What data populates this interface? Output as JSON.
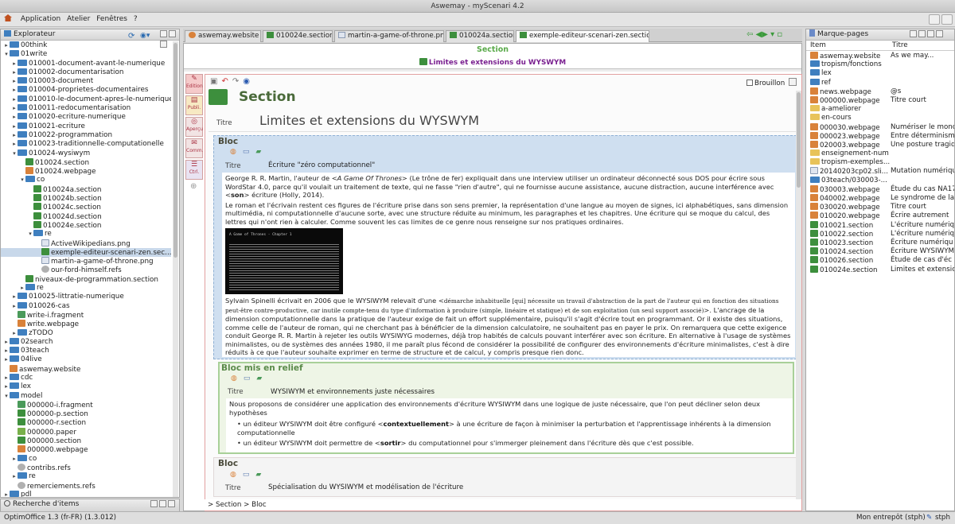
{
  "window_title": "Aswemay - myScenari 4.2",
  "menu": [
    "Application",
    "Atelier",
    "Fenêtres",
    "?"
  ],
  "explorer": {
    "title": "Explorateur",
    "items": [
      {
        "d": 0,
        "a": "▸",
        "t": "folder",
        "label": "00think"
      },
      {
        "d": 0,
        "a": "▾",
        "t": "folder",
        "label": "01write"
      },
      {
        "d": 1,
        "a": "▸",
        "t": "folder",
        "label": "010001-document-avant-le-numerique"
      },
      {
        "d": 1,
        "a": "▸",
        "t": "folder",
        "label": "010002-documentarisation"
      },
      {
        "d": 1,
        "a": "▸",
        "t": "folder",
        "label": "010003-document"
      },
      {
        "d": 1,
        "a": "▸",
        "t": "folder",
        "label": "010004-proprietes-documentaires"
      },
      {
        "d": 1,
        "a": "▸",
        "t": "folder",
        "label": "010010-le-document-apres-le-numerique"
      },
      {
        "d": 1,
        "a": "▸",
        "t": "folder",
        "label": "010011-redocumentarisation"
      },
      {
        "d": 1,
        "a": "▸",
        "t": "folder",
        "label": "010020-ecriture-numerique"
      },
      {
        "d": 1,
        "a": "▸",
        "t": "folder",
        "label": "010021-ecriture"
      },
      {
        "d": 1,
        "a": "▸",
        "t": "folder",
        "label": "010022-programmation"
      },
      {
        "d": 1,
        "a": "▸",
        "t": "folder",
        "label": "010023-traditionnelle-computationelle"
      },
      {
        "d": 1,
        "a": "▾",
        "t": "folder",
        "label": "010024-wysiwym"
      },
      {
        "d": 2,
        "a": "",
        "t": "sec",
        "label": "010024.section"
      },
      {
        "d": 2,
        "a": "",
        "t": "web",
        "label": "010024.webpage"
      },
      {
        "d": 2,
        "a": "▾",
        "t": "folder",
        "label": "co"
      },
      {
        "d": 3,
        "a": "",
        "t": "sec",
        "label": "010024a.section"
      },
      {
        "d": 3,
        "a": "",
        "t": "sec",
        "label": "010024b.section"
      },
      {
        "d": 3,
        "a": "",
        "t": "sec",
        "label": "010024c.section"
      },
      {
        "d": 3,
        "a": "",
        "t": "sec",
        "label": "010024d.section"
      },
      {
        "d": 3,
        "a": "",
        "t": "sec",
        "label": "010024e.section"
      },
      {
        "d": 3,
        "a": "▾",
        "t": "folder",
        "label": "re"
      },
      {
        "d": 4,
        "a": "",
        "t": "img",
        "label": "ActiveWikipedians.png"
      },
      {
        "d": 4,
        "a": "",
        "t": "sec",
        "label": "exemple-editeur-scenari-zen.sec...",
        "sel": true
      },
      {
        "d": 4,
        "a": "",
        "t": "img",
        "label": "martin-a-game-of-throne.png"
      },
      {
        "d": 4,
        "a": "",
        "t": "ref",
        "label": "our-ford-himself.refs"
      },
      {
        "d": 2,
        "a": "",
        "t": "sec",
        "label": "niveaux-de-programmation.section"
      },
      {
        "d": 2,
        "a": "▸",
        "t": "folder",
        "label": "re"
      },
      {
        "d": 1,
        "a": "▸",
        "t": "folder",
        "label": "010025-littratie-numerique"
      },
      {
        "d": 1,
        "a": "▸",
        "t": "folder",
        "label": "010026-cas"
      },
      {
        "d": 1,
        "a": "",
        "t": "frag",
        "label": "write-i.fragment"
      },
      {
        "d": 1,
        "a": "",
        "t": "web",
        "label": "write.webpage"
      },
      {
        "d": 1,
        "a": "▸",
        "t": "folder",
        "label": "zTODO"
      },
      {
        "d": 0,
        "a": "▸",
        "t": "folder",
        "label": "02search"
      },
      {
        "d": 0,
        "a": "▸",
        "t": "folder",
        "label": "03teach"
      },
      {
        "d": 0,
        "a": "▸",
        "t": "folder",
        "label": "04live"
      },
      {
        "d": 0,
        "a": "",
        "t": "web",
        "label": "aswemay.website"
      },
      {
        "d": 0,
        "a": "▸",
        "t": "folder",
        "label": "cdc"
      },
      {
        "d": 0,
        "a": "▸",
        "t": "folder",
        "label": "lex"
      },
      {
        "d": 0,
        "a": "▾",
        "t": "folder",
        "label": "model"
      },
      {
        "d": 1,
        "a": "",
        "t": "frag",
        "label": "000000-i.fragment"
      },
      {
        "d": 1,
        "a": "",
        "t": "sec",
        "label": "000000-p.section"
      },
      {
        "d": 1,
        "a": "",
        "t": "sec",
        "label": "000000-r.section"
      },
      {
        "d": 1,
        "a": "",
        "t": "pap",
        "label": "000000.paper"
      },
      {
        "d": 1,
        "a": "",
        "t": "sec",
        "label": "000000.section"
      },
      {
        "d": 1,
        "a": "",
        "t": "web",
        "label": "000000.webpage"
      },
      {
        "d": 1,
        "a": "▸",
        "t": "folder",
        "label": "co"
      },
      {
        "d": 1,
        "a": "",
        "t": "ref",
        "label": "contribs.refs"
      },
      {
        "d": 1,
        "a": "▸",
        "t": "folder",
        "label": "re"
      },
      {
        "d": 1,
        "a": "",
        "t": "ref",
        "label": "remerciements.refs"
      },
      {
        "d": 0,
        "a": "▸",
        "t": "folder",
        "label": "pdl"
      }
    ]
  },
  "search_panel": "Recherche d'items",
  "tabs": [
    "aswemay.website",
    "010024e.section",
    "martin-a-game-of-throne.png",
    "010024a.section",
    "exemple-editeur-scenari-zen.section"
  ],
  "doc": {
    "header_type": "Section",
    "header_title": "Limites et extensions du WYSWYM",
    "sidetabs": [
      "Edition",
      "Publi.",
      "Aperçu",
      "Comm.",
      "Ctrl."
    ],
    "brouillon": "Brouillon",
    "section_label": "Section",
    "titre_label": "Titre",
    "section_title": "Limites et extensions du WYSWYM",
    "bloc1": {
      "label": "Bloc",
      "titre": "Écriture \"zéro computationnel\"",
      "p1a": "George R. R. Martin, l'auteur de <",
      "p1b": "A Game Of Thrones",
      "p1c": "> (Le trône de fer) expliquait dans une interview utiliser un ordinateur déconnecté sous DOS pour écrire sous WordStar 4.0, parce qu'il voulait un traitement de texte, qui ne fasse \"rien d'autre\", qui ne fournisse aucune assistance, aucune distraction, aucune interférence avec <",
      "p1d": "son",
      "p1e": "> écriture (Holly, 2014).",
      "p2": "Le roman et l'écrivain restent ces figures de l'écriture prise dans son sens premier, la représentation d'une langue au moyen de signes, ici alphabétiques, sans dimension multimédia, ni computationnelle d'aucune sorte, avec une structure réduite au minimum, les paragraphes et les chapitres. Une écriture qui se moque du calcul, des lettres qui n'ont rien à calculer. Comme souvent les cas limites de ce genre nous renseigne sur nos pratiques ordinaires.",
      "p3a": "Sylvain Spinelli écrivait en 2006 que le WYSIWYM relevait d'une <",
      "p3b": "démarche inhabituelle [qui] nécessite un travail d'abstraction de la part de l'auteur qui en fonction des situations peut-être contre-productive, car inutile compte-tenu du type d'information à produire (simple, linéaire et statique) et de son exploitation (un seul support associé)",
      "p3c": ">. L'ancrage de la dimension computationnelle dans la pratique de l'auteur exige de fait un effort supplémentaire, puisqu'il s'agit d'écrire tout en programmant. Or il existe des situations, comme celle de l'auteur de roman, qui ne cherchant pas à bénéficier de la dimension calculatoire, ne souhaitent pas en payer le prix. On remarquera que cette exigence conduit George R. R. Martin à rejeter les outils WYSIWYG modernes, déjà trop habités de calculs pouvant interférer avec son écriture. En alternative à l'usage de systèmes minimalistes, ou de systèmes des années 1980, il me paraît plus fécond de considérer la possibilité de configurer des environnements d'écriture minimalistes, c'est à dire réduits à ce que l'auteur souhaite exprimer en terme de structure et de calcul, y compris presque rien donc.",
      "screen_title": "A Game of Thrones - Chapter 1"
    },
    "bloc2": {
      "label": "Bloc mis en relief",
      "titre": "WYSIWYM et environnements juste nécessaires",
      "p1": "Nous proposons de considérer une application des environnements d'écriture WYSIWYM dans une logique de juste nécessaire, que l'on peut décliner selon deux hypothèses",
      "li1a": "un éditeur WYSIWYM doit être configuré <",
      "li1b": "contextuellement",
      "li1c": "> à une écriture de façon à minimiser la perturbation et l'apprentissage inhérents à la dimension computationnelle",
      "li2a": "un éditeur WYSIWYM doit permettre de <",
      "li2b": "sortir",
      "li2c": "> du computationnel pour s'immerger pleinement dans l'écriture dès que c'est possible."
    },
    "bloc3": {
      "label": "Bloc",
      "titre": "Spécialisation du WYSIWYM et modélisation de l'écriture"
    },
    "breadcrumb": [
      "Section",
      "Bloc"
    ]
  },
  "bookmarks": {
    "title": "Marque-pages",
    "col_item": "Item",
    "col_titre": "Titre",
    "rows": [
      {
        "t": "web",
        "item": "aswemay.website",
        "titre": "As we may..."
      },
      {
        "t": "folder",
        "item": "tropism/fonctions",
        "titre": ""
      },
      {
        "t": "folder",
        "item": "lex",
        "titre": ""
      },
      {
        "t": "folder",
        "item": "ref",
        "titre": ""
      },
      {
        "t": "web",
        "item": "news.webpage",
        "titre": "@s"
      },
      {
        "t": "web",
        "item": "000000.webpage",
        "titre": "Titre court"
      },
      {
        "t": "yfolder",
        "item": "a-ameliorer",
        "titre": ""
      },
      {
        "t": "yfolder",
        "item": "en-cours",
        "titre": ""
      },
      {
        "t": "web",
        "item": "000030.webpage",
        "titre": "Numériser le monc"
      },
      {
        "t": "web",
        "item": "000023.webpage",
        "titre": "Entre déterminism"
      },
      {
        "t": "web",
        "item": "020003.webpage",
        "titre": "Une posture tragiq"
      },
      {
        "t": "yfolder",
        "item": "enseignement-num",
        "titre": ""
      },
      {
        "t": "yfolder",
        "item": "tropism-exemples...",
        "titre": ""
      },
      {
        "t": "img",
        "item": "20140203cp02.sli...",
        "titre": "Mutation numériqu"
      },
      {
        "t": "folder",
        "item": "03teach/030003-...",
        "titre": ""
      },
      {
        "t": "web",
        "item": "030003.webpage",
        "titre": "Étude du cas NA17"
      },
      {
        "t": "web",
        "item": "040002.webpage",
        "titre": "Le syndrome de la"
      },
      {
        "t": "web",
        "item": "030020.webpage",
        "titre": "Titre court"
      },
      {
        "t": "web",
        "item": "010020.webpage",
        "titre": "Écrire autrement"
      },
      {
        "t": "sec",
        "item": "010021.section",
        "titre": "L'écriture numériq"
      },
      {
        "t": "sec",
        "item": "010022.section",
        "titre": "L'écriture numériq"
      },
      {
        "t": "sec",
        "item": "010023.section",
        "titre": "Écriture numériqu"
      },
      {
        "t": "sec",
        "item": "010024.section",
        "titre": "Écriture WYSIWYM"
      },
      {
        "t": "sec",
        "item": "010026.section",
        "titre": "Étude de cas d'éc"
      },
      {
        "t": "sec",
        "item": "010024e.section",
        "titre": "Limites et extensic"
      }
    ]
  },
  "status": {
    "left": "OptimOffice 1.3 (fr-FR) (1.3.012)",
    "right": "Mon entrepôt (stph)",
    "user": "stph"
  },
  "colors": {
    "green_title": "#5aaa4a",
    "purple": "#7a2090",
    "section_green": "#4a6a3a",
    "bloc_bg": "#cfdff0"
  }
}
